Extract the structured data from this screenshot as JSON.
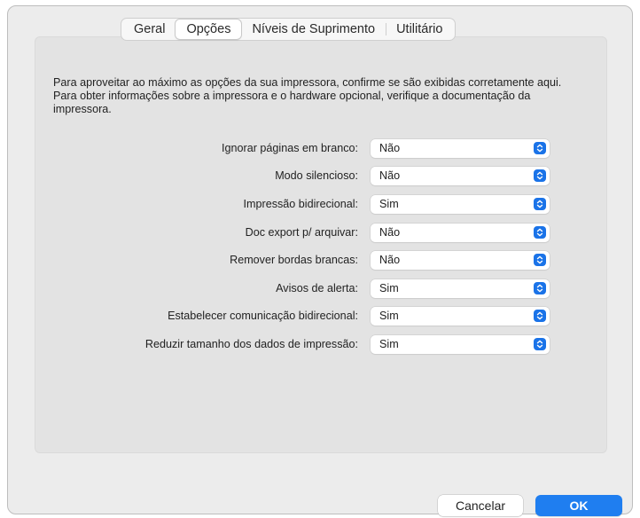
{
  "tabs": [
    {
      "label": "Geral",
      "active": false
    },
    {
      "label": "Opções",
      "active": true
    },
    {
      "label": "Níveis de Suprimento",
      "active": false
    },
    {
      "label": "Utilitário",
      "active": false
    }
  ],
  "description": "Para aproveitar ao máximo as opções da sua impressora, confirme se são exibidas corretamente aqui. Para obter informações sobre a impressora e o hardware opcional, verifique a documentação da impressora.",
  "settings": [
    {
      "label": "Ignorar páginas em branco:",
      "value": "Não"
    },
    {
      "label": "Modo silencioso:",
      "value": "Não"
    },
    {
      "label": "Impressão bidirecional:",
      "value": "Sim"
    },
    {
      "label": "Doc export p/ arquivar:",
      "value": "Não"
    },
    {
      "label": "Remover bordas brancas:",
      "value": "Não"
    },
    {
      "label": "Avisos de alerta:",
      "value": "Sim"
    },
    {
      "label": "Estabelecer comunicação bidirecional:",
      "value": "Sim"
    },
    {
      "label": "Reduzir tamanho dos dados de impressão:",
      "value": "Sim"
    }
  ],
  "buttons": {
    "cancel": "Cancelar",
    "ok": "OK"
  },
  "colors": {
    "accent": "#1f7ef0",
    "window_bg": "#ececec",
    "panel_bg": "#e3e3e3"
  },
  "icons": {
    "select_indicator": "chevron-up-down-icon"
  }
}
